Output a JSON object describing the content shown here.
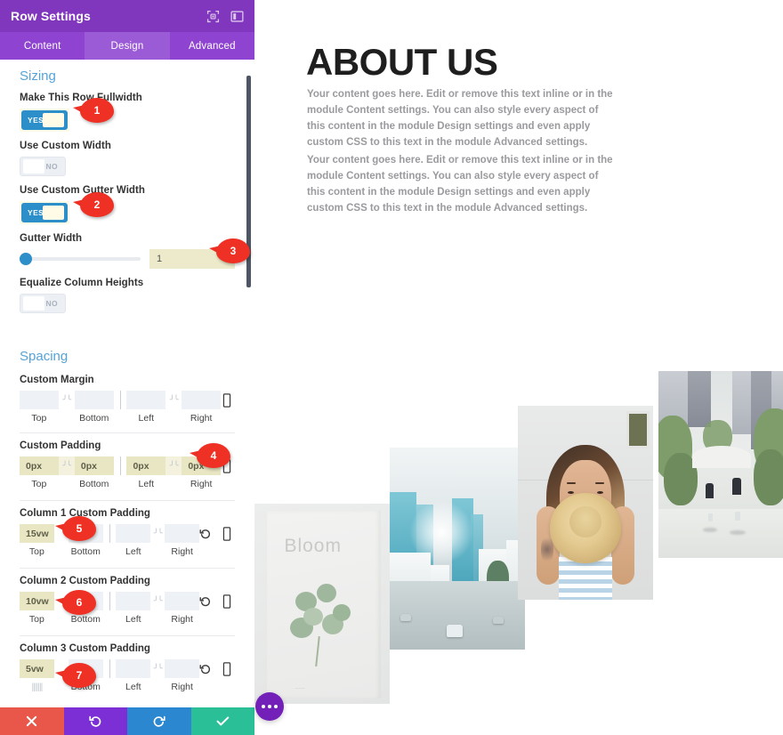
{
  "panel": {
    "title": "Row Settings",
    "header_icons": [
      {
        "name": "fullscreen-expand-icon"
      },
      {
        "name": "panel-layout-icon"
      }
    ],
    "tabs": [
      {
        "label": "Content",
        "active": false
      },
      {
        "label": "Design",
        "active": true
      },
      {
        "label": "Advanced",
        "active": false
      }
    ],
    "sections": [
      {
        "title": "Sizing",
        "fields": [
          {
            "label": "Make This Row Fullwidth",
            "type": "toggle",
            "value": "YES",
            "on": true,
            "highlighted": true
          },
          {
            "label": "Use Custom Width",
            "type": "toggle",
            "value": "NO",
            "on": false,
            "highlighted": false
          },
          {
            "label": "Use Custom Gutter Width",
            "type": "toggle",
            "value": "YES",
            "on": true,
            "highlighted": true
          },
          {
            "label": "Gutter Width",
            "type": "slider",
            "value": "1",
            "slider_pos": 0
          },
          {
            "label": "Equalize Column Heights",
            "type": "toggle",
            "value": "NO",
            "on": false,
            "highlighted": false
          }
        ]
      },
      {
        "title": "Spacing",
        "spacing_rows": [
          {
            "label": "Custom Margin",
            "filled": false,
            "values": [
              "",
              "",
              "",
              ""
            ],
            "captions": [
              "Top",
              "Bottom",
              "Left",
              "Right"
            ],
            "link_icon": "broken-link-icon",
            "has_reset": false,
            "has_device": true
          },
          {
            "label": "Custom Padding",
            "filled": true,
            "values": [
              "0px",
              "0px",
              "0px",
              "0px"
            ],
            "captions": [
              "Top",
              "Bottom",
              "Left",
              "Right"
            ],
            "link_icon": "broken-link-icon",
            "has_reset": false,
            "has_device": true
          },
          {
            "label": "Column 1 Custom Padding",
            "filled": false,
            "values": [
              "15vw",
              "",
              "",
              ""
            ],
            "captions": [
              "Top",
              "Bottom",
              "Left",
              "Right"
            ],
            "link_icon": "broken-link-icon",
            "has_reset": true,
            "has_device": true
          },
          {
            "label": "Column 2 Custom Padding",
            "filled": false,
            "values": [
              "10vw",
              "",
              "",
              ""
            ],
            "captions": [
              "Top",
              "Bottom",
              "Left",
              "Right"
            ],
            "link_icon": "broken-link-icon",
            "has_reset": true,
            "has_device": true
          },
          {
            "label": "Column 3 Custom Padding",
            "filled": false,
            "values": [
              "5vw",
              "",
              "",
              ""
            ],
            "captions": [
              "Top",
              "Bottom",
              "Left",
              "Right"
            ],
            "link_icon": "broken-link-icon",
            "has_reset": true,
            "has_device": true
          }
        ]
      }
    ],
    "action_buttons": [
      {
        "name": "cancel-button",
        "icon": "close-icon",
        "color": "#e8574a"
      },
      {
        "name": "undo-button",
        "icon": "undo-icon",
        "color": "#7b2fd4"
      },
      {
        "name": "redo-button",
        "icon": "redo-icon",
        "color": "#2b87cf"
      },
      {
        "name": "save-button",
        "icon": "check-icon",
        "color": "#2bbf97"
      }
    ]
  },
  "callouts": [
    {
      "number": "1"
    },
    {
      "number": "2"
    },
    {
      "number": "3"
    },
    {
      "number": "4"
    },
    {
      "number": "5"
    },
    {
      "number": "6"
    },
    {
      "number": "7"
    }
  ],
  "content": {
    "heading": "ABOUT US",
    "paragraph_1": "Your content goes here. Edit or remove this text inline or in the module Content settings. You can also style every aspect of this content in the module Design settings and even apply custom CSS to this text in the module Advanced settings.",
    "paragraph_2": "Your content goes here. Edit or remove this text inline or in the module Content settings. You can also style every aspect of this content in the module Design settings and even apply custom CSS to this text in the module Advanced settings.",
    "images": [
      {
        "name": "photo-bloom-book",
        "caption": "Bloom"
      },
      {
        "name": "photo-city-street-sunset"
      },
      {
        "name": "photo-woman-with-hat"
      },
      {
        "name": "photo-tree-lined-street"
      }
    ],
    "fab": {
      "name": "page-settings-fab",
      "icon": "ellipsis-icon"
    }
  },
  "colors": {
    "panel_header": "#8136be",
    "tab_bar": "#8e44d0",
    "tab_active": "#9b5bd6",
    "section_heading": "#55a3d8",
    "toggle_on": "#2d8fc9",
    "field_highlight": "#e9e6c4",
    "callout": "#ee3124",
    "fab": "#7320b9"
  }
}
